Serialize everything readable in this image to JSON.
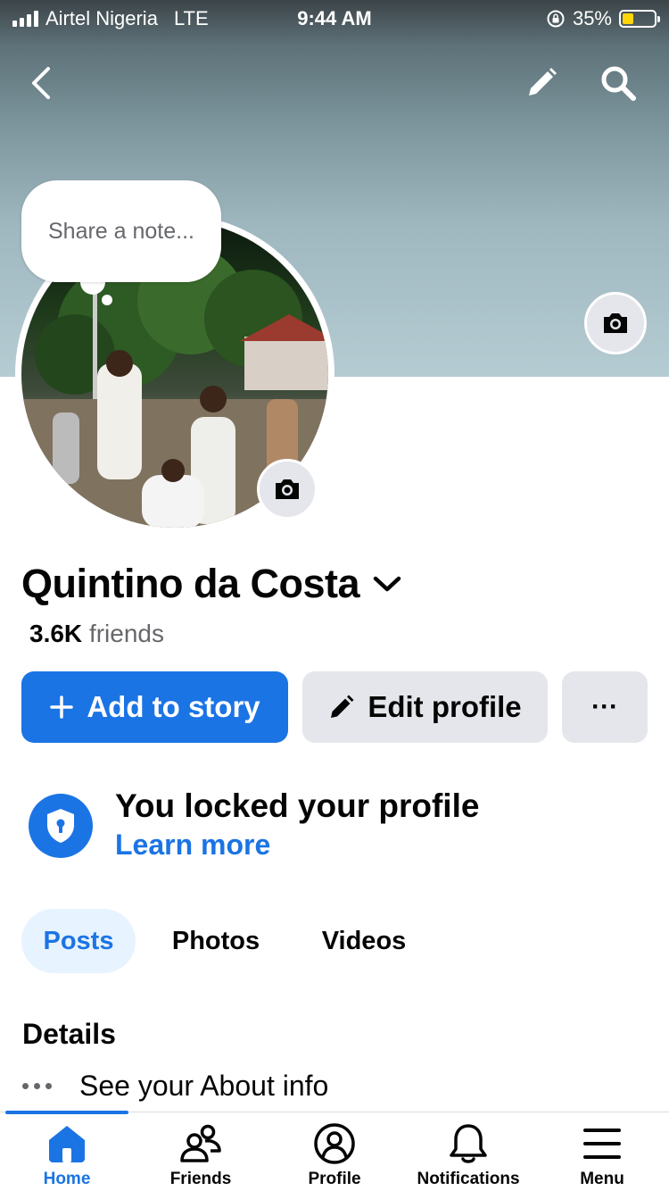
{
  "status_bar": {
    "carrier": "Airtel Nigeria",
    "network": "LTE",
    "time": "9:44 AM",
    "battery": "35%",
    "battery_level": 0.35
  },
  "header": {
    "back_icon": "chevron-left-icon",
    "edit_icon": "pencil-icon",
    "search_icon": "search-icon"
  },
  "profile": {
    "note_placeholder": "Share a note...",
    "name": "Quintino da Costa",
    "friends_count": "3.6K",
    "friends_label": "friends"
  },
  "actions": {
    "add_story": "Add to story",
    "edit_profile": "Edit profile",
    "more": "···"
  },
  "locked": {
    "title": "You locked your profile",
    "link": "Learn more"
  },
  "tabs": [
    {
      "label": "Posts",
      "active": true
    },
    {
      "label": "Photos",
      "active": false
    },
    {
      "label": "Videos",
      "active": false
    }
  ],
  "details": {
    "title": "Details",
    "about": "See your About info"
  },
  "bottom_nav": [
    {
      "label": "Home",
      "icon": "home-icon",
      "active": true
    },
    {
      "label": "Friends",
      "icon": "friends-icon",
      "active": false
    },
    {
      "label": "Profile",
      "icon": "profile-icon",
      "active": false
    },
    {
      "label": "Notifications",
      "icon": "bell-icon",
      "active": false
    },
    {
      "label": "Menu",
      "icon": "menu-icon",
      "active": false
    }
  ],
  "colors": {
    "accent": "#1b74e4",
    "secondary_button": "#e4e6eb",
    "battery": "#ffd60a"
  }
}
